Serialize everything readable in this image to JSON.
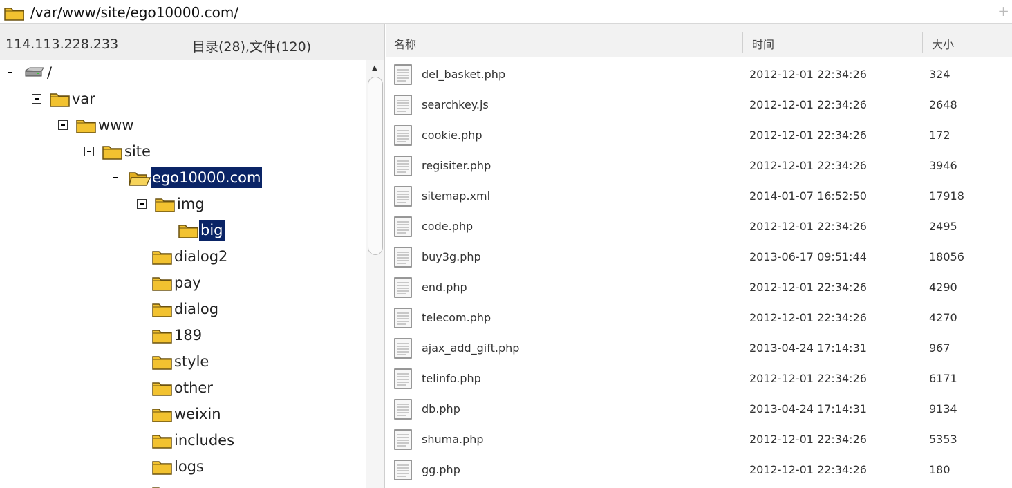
{
  "path_bar": {
    "path": "/var/www/site/ego10000.com/",
    "plus": "+"
  },
  "left_panel": {
    "ip": "114.113.228.233",
    "counts": "目录(28),文件(120)",
    "tree": [
      {
        "label": "/",
        "icon": "drive-icon",
        "toggle": true,
        "depth": 0
      },
      {
        "label": "var",
        "icon": "folder-icon",
        "toggle": true,
        "depth": 1
      },
      {
        "label": "www",
        "icon": "folder-icon",
        "toggle": true,
        "depth": 2
      },
      {
        "label": "site",
        "icon": "folder-icon",
        "toggle": true,
        "depth": 3
      },
      {
        "label": "ego10000.com",
        "icon": "folder-open-icon",
        "toggle": true,
        "depth": 4,
        "selected": true
      },
      {
        "label": "img",
        "icon": "folder-icon",
        "toggle": true,
        "depth": 5
      },
      {
        "label": "big",
        "icon": "folder-icon",
        "toggle": false,
        "depth": 6,
        "selected": true
      },
      {
        "label": "dialog2",
        "icon": "folder-icon",
        "toggle": false,
        "depth": 5
      },
      {
        "label": "pay",
        "icon": "folder-icon",
        "toggle": false,
        "depth": 5
      },
      {
        "label": "dialog",
        "icon": "folder-icon",
        "toggle": false,
        "depth": 5
      },
      {
        "label": "189",
        "icon": "folder-icon",
        "toggle": false,
        "depth": 5
      },
      {
        "label": "style",
        "icon": "folder-icon",
        "toggle": false,
        "depth": 5
      },
      {
        "label": "other",
        "icon": "folder-icon",
        "toggle": false,
        "depth": 5
      },
      {
        "label": "weixin",
        "icon": "folder-icon",
        "toggle": false,
        "depth": 5
      },
      {
        "label": "includes",
        "icon": "folder-icon",
        "toggle": false,
        "depth": 5
      },
      {
        "label": "logs",
        "icon": "folder-icon",
        "toggle": false,
        "depth": 5
      },
      {
        "label": "",
        "icon": "folder-icon",
        "toggle": false,
        "depth": 5
      }
    ],
    "scroll_up_glyph": "▲"
  },
  "file_list": {
    "columns": {
      "name": "名称",
      "time": "时间",
      "size": "大小"
    },
    "rows": [
      {
        "name": "del_basket.php",
        "time": "2012-12-01 22:34:26",
        "size": "324"
      },
      {
        "name": "searchkey.js",
        "time": "2012-12-01 22:34:26",
        "size": "2648"
      },
      {
        "name": "cookie.php",
        "time": "2012-12-01 22:34:26",
        "size": "172"
      },
      {
        "name": "regisiter.php",
        "time": "2012-12-01 22:34:26",
        "size": "3946"
      },
      {
        "name": "sitemap.xml",
        "time": "2014-01-07 16:52:50",
        "size": "17918"
      },
      {
        "name": "code.php",
        "time": "2012-12-01 22:34:26",
        "size": "2495"
      },
      {
        "name": "buy3g.php",
        "time": "2013-06-17 09:51:44",
        "size": "18056"
      },
      {
        "name": "end.php",
        "time": "2012-12-01 22:34:26",
        "size": "4290"
      },
      {
        "name": "telecom.php",
        "time": "2012-12-01 22:34:26",
        "size": "4270"
      },
      {
        "name": "ajax_add_gift.php",
        "time": "2013-04-24 17:14:31",
        "size": "967"
      },
      {
        "name": "telinfo.php",
        "time": "2012-12-01 22:34:26",
        "size": "6171"
      },
      {
        "name": "db.php",
        "time": "2013-04-24 17:14:31",
        "size": "9134"
      },
      {
        "name": "shuma.php",
        "time": "2012-12-01 22:34:26",
        "size": "5353"
      },
      {
        "name": "gg.php",
        "time": "2012-12-01 22:34:26",
        "size": "180"
      }
    ]
  },
  "colors": {
    "selection": "#0a2466",
    "folder": "#f2c230",
    "panel_bg": "#eeeeee"
  }
}
